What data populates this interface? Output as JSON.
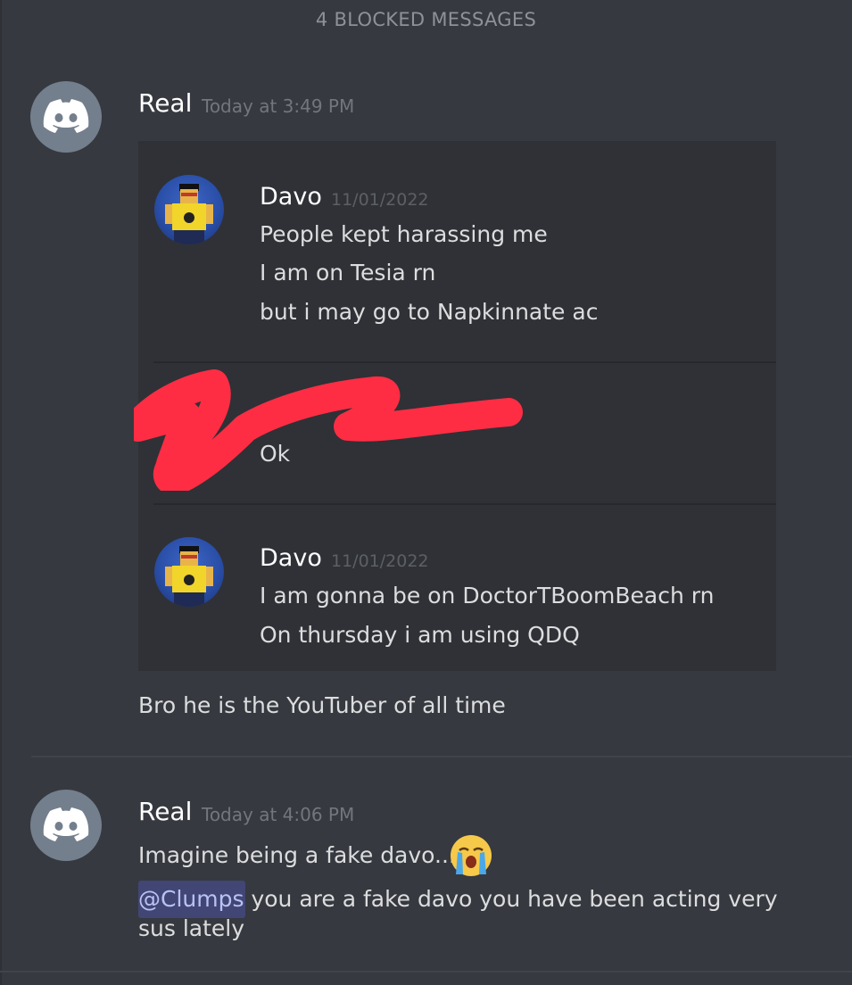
{
  "blocked_banner": "4 BLOCKED MESSAGES",
  "messages": [
    {
      "author": "Real",
      "timestamp": "Today at 3:49 PM",
      "embed": {
        "items": [
          {
            "author": "Davo",
            "timestamp": "11/01/2022",
            "lines": [
              "People kept harassing me",
              "I am on Tesia rn",
              "but i may go to Napkinnate ac"
            ]
          },
          {
            "author": "",
            "timestamp": "",
            "lines": [
              "Ok"
            ]
          },
          {
            "author": "Davo",
            "timestamp": "11/01/2022",
            "lines": [
              "I am gonna be on DoctorTBoomBeach rn",
              "On thursday i am using QDQ"
            ]
          }
        ]
      },
      "text": "Bro he is the YouTuber of all time"
    },
    {
      "author": "Real",
      "timestamp": "Today at 4:06 PM",
      "line1": "Imagine being a fake davo...",
      "emoji": "loudly-crying-face",
      "mention": "@Clumps",
      "line2_rest": " you are a fake davo you have been acting very",
      "line2_cont": "sus lately"
    }
  ],
  "colors": {
    "background": "#36393f",
    "embed": "#2f3136",
    "mention_bg": "#414675",
    "mention_text": "#b9c2f5",
    "scribble": "#ff2d44"
  }
}
